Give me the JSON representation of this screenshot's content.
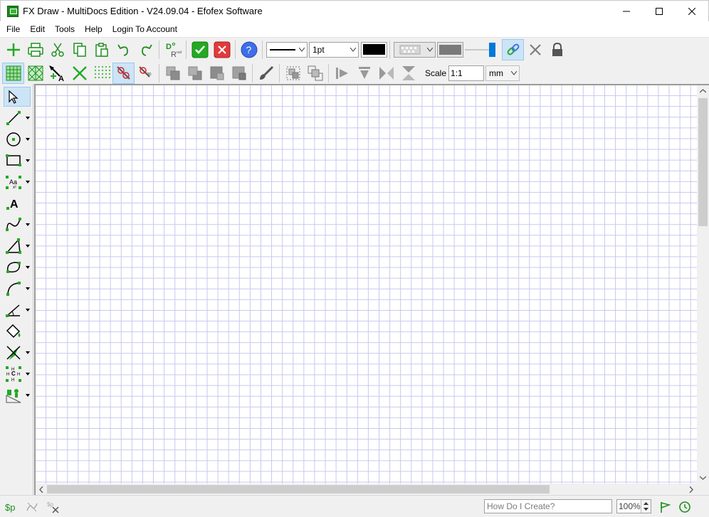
{
  "window": {
    "title": "FX Draw - MultiDocs Edition - V24.09.04 - Efofex Software"
  },
  "menu": {
    "items": [
      "File",
      "Edit",
      "Tools",
      "Help",
      "Login To Account"
    ]
  },
  "toolbar1": {
    "line_width_value": "1pt",
    "line_color": "#000000"
  },
  "toolbar2": {
    "scale_label": "Scale",
    "scale_value": "1:1",
    "unit_value": "mm"
  },
  "statusbar": {
    "p_label": "$p",
    "howdo_placeholder": "How Do I Create?",
    "zoom_value": "100%"
  },
  "colors": {
    "accent_green": "#22aa22",
    "grid_line": "#c7c7ef",
    "help_blue": "#3f6fe8",
    "cancel_red": "#e33a3a"
  }
}
